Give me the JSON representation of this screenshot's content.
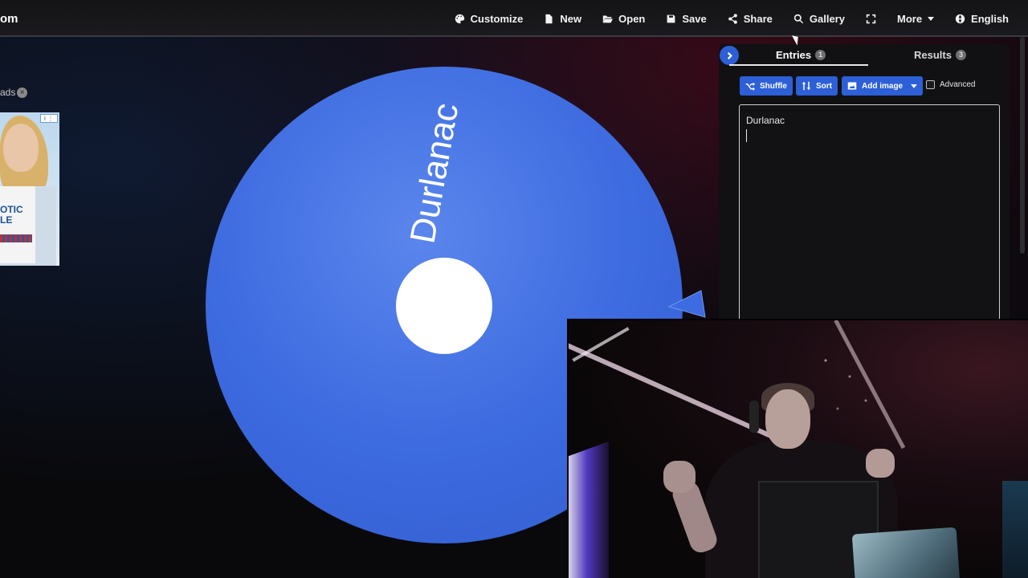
{
  "brand": {
    "text": "om"
  },
  "nav": {
    "customize": "Customize",
    "new": "New",
    "open": "Open",
    "save": "Save",
    "share": "Share",
    "gallery": "Gallery",
    "more": "More",
    "language": "English"
  },
  "ads": {
    "label": "ads",
    "close": "×",
    "ad_text_1": "OTIC",
    "ad_text_2": "LE"
  },
  "wheel": {
    "color": "#3d6be0",
    "entry_label": "Durlanac",
    "pointer_color": "#3d6be0"
  },
  "panel": {
    "tabs": {
      "entries": {
        "label": "Entries",
        "count": "1"
      },
      "results": {
        "label": "Results",
        "count": "3"
      }
    },
    "toolbar": {
      "shuffle": "Shuffle",
      "sort": "Sort",
      "add_image": "Add image",
      "advanced": "Advanced"
    },
    "entries_text": "Durlanac"
  },
  "colors": {
    "accent": "#2d5fd6",
    "wheel": "#3d6be0"
  }
}
